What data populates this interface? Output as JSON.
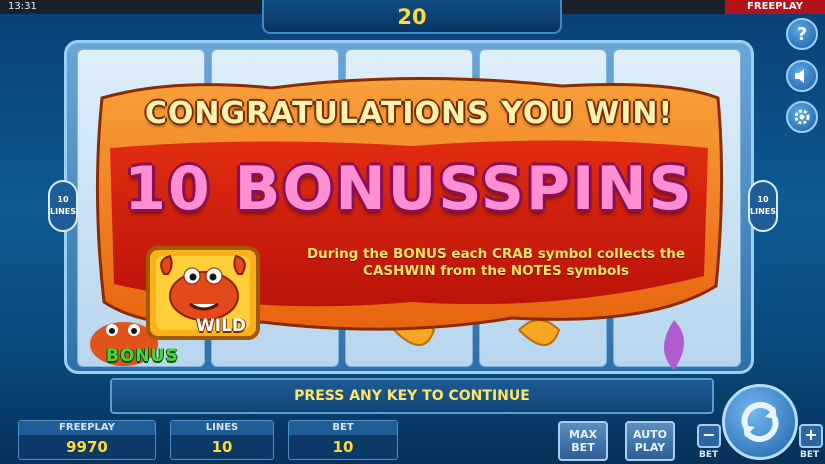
{
  "status": {
    "time": "13:31",
    "mode_badge": "FREEPLAY"
  },
  "win_counter": "20",
  "reels": {
    "lines_badge_left": "10 LINES",
    "lines_badge_right": "10 LINES",
    "bonus_symbol_text": "BONUS"
  },
  "popup": {
    "headline": "CONGRATULATIONS YOU WIN!",
    "spins_text": "10 BONUSSPINS",
    "info": "During the BONUS each CRAB symbol collects the CASHWIN from the NOTES symbols",
    "wild_label": "WILD"
  },
  "continue_prompt": "PRESS ANY KEY TO CONTINUE",
  "panels": {
    "balance": {
      "label": "FREEPLAY",
      "value": "9970"
    },
    "lines": {
      "label": "LINES",
      "value": "10"
    },
    "bet": {
      "label": "BET",
      "value": "10"
    }
  },
  "buttons": {
    "max_bet": "MAX BET",
    "auto_play": "AUTO PLAY",
    "bet_minus": "−",
    "bet_plus": "+",
    "bet_label": "BET",
    "help": "?"
  },
  "icons": [
    "help-icon",
    "sound-icon",
    "settings-icon",
    "spin-arrows-icon",
    "crab-icon"
  ],
  "colors": {
    "popup_orange": "#f28a1e",
    "popup_red": "#c8120e",
    "text_yellow": "#ffe566",
    "pink_text": "#ff8ed3"
  }
}
